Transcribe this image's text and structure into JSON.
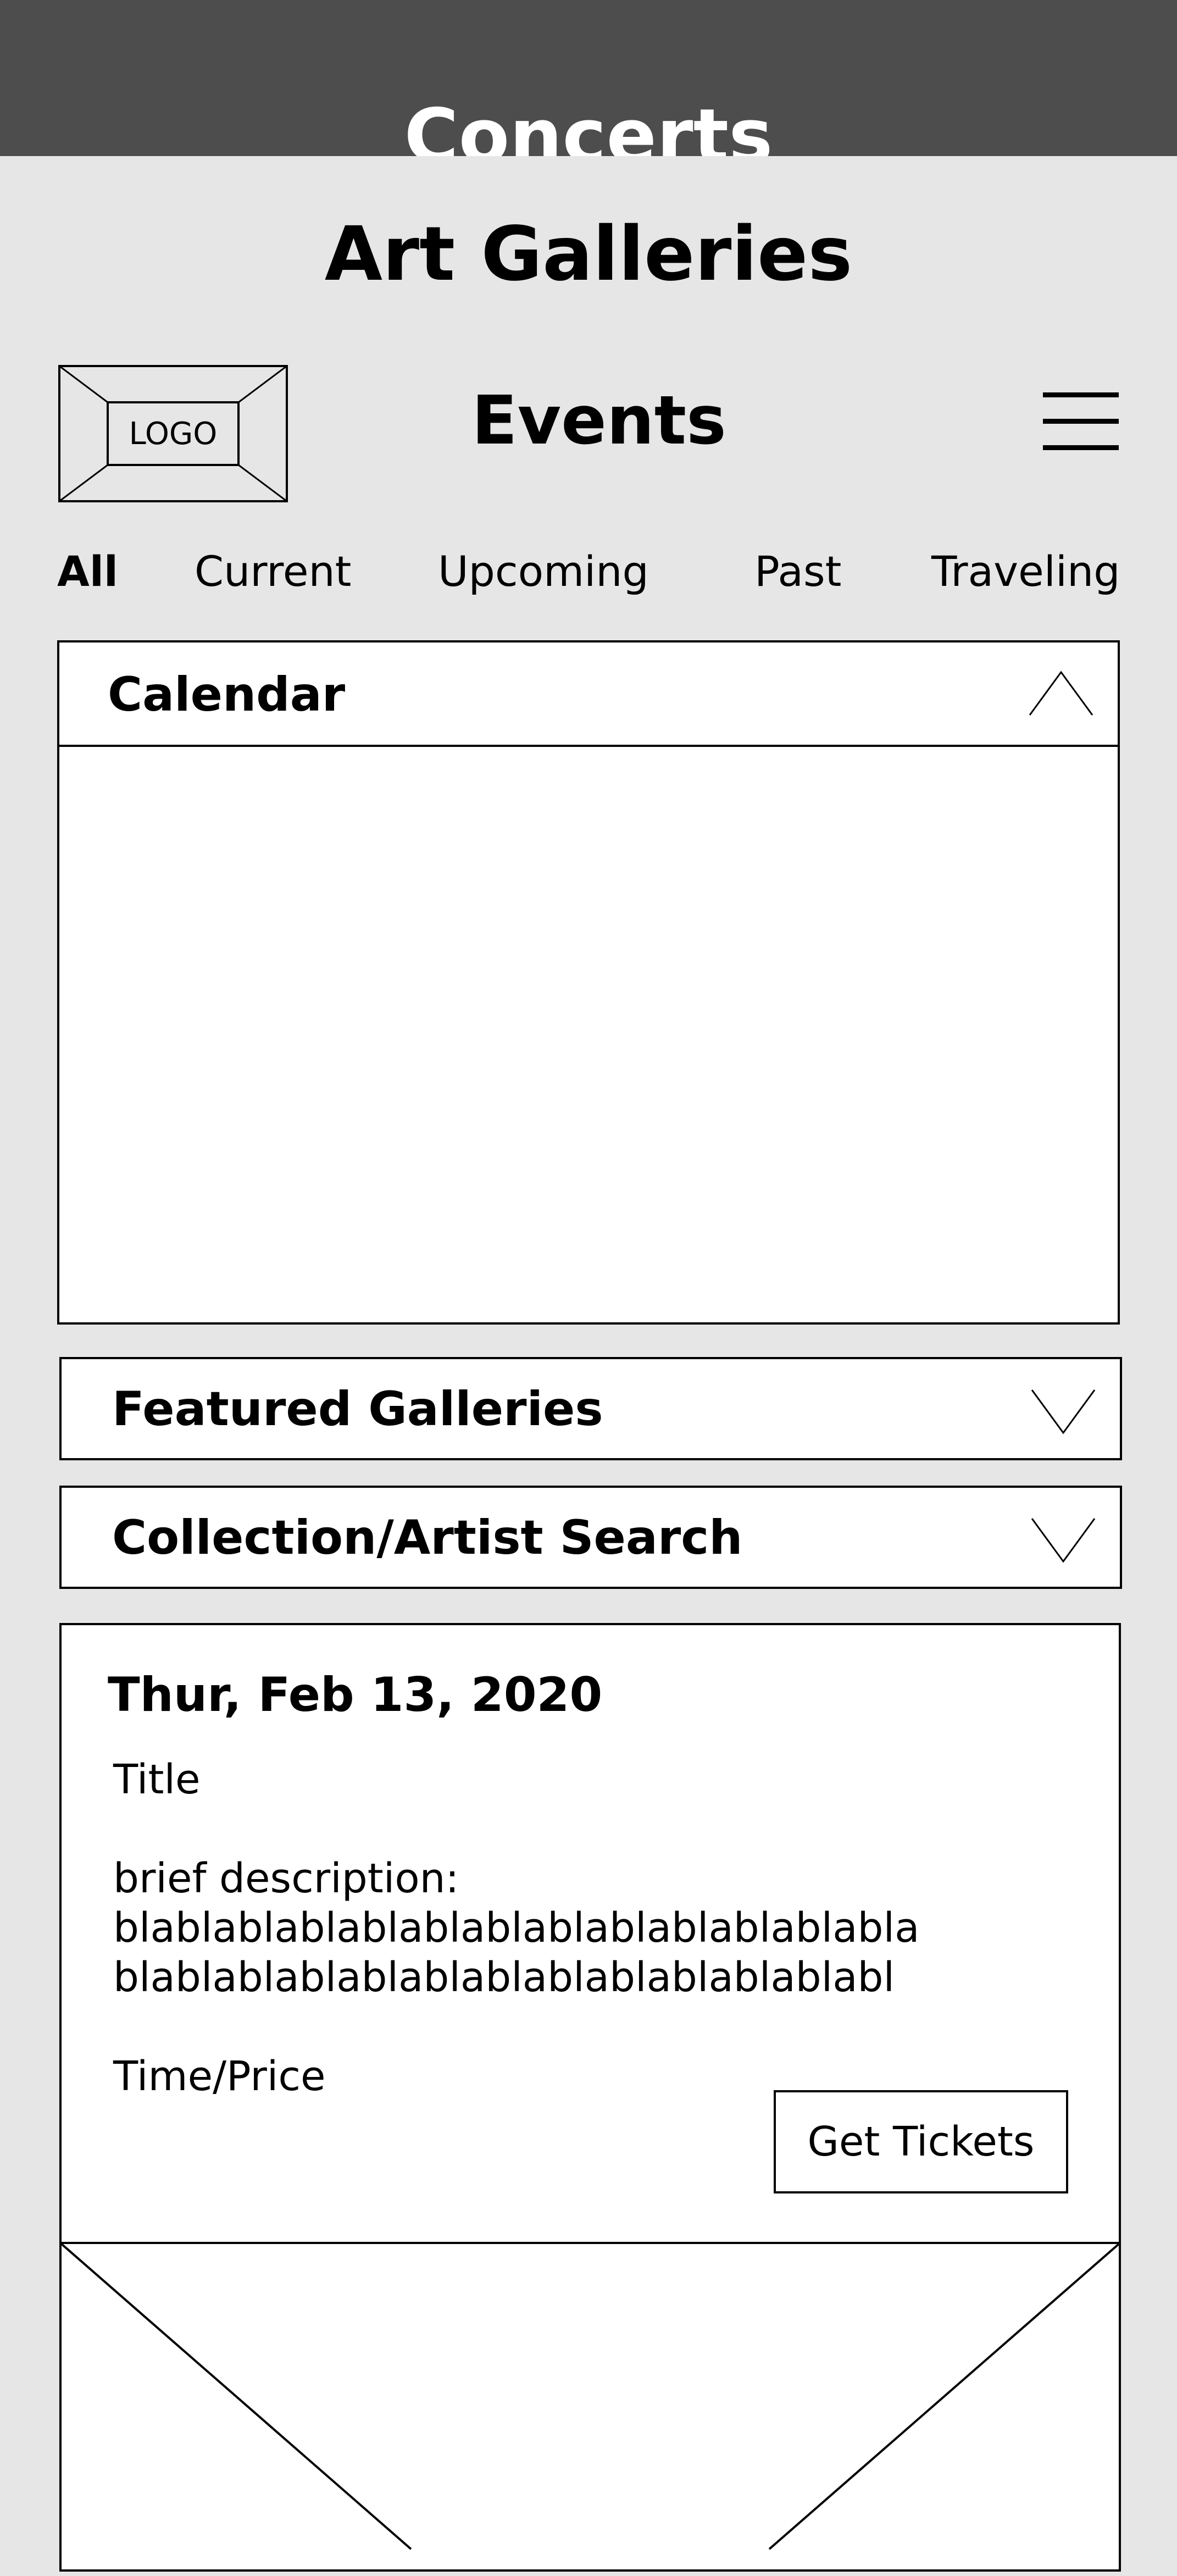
{
  "overlay": {
    "title": "Concerts"
  },
  "page": {
    "title": "Art Galleries"
  },
  "header": {
    "logo_label": "LOGO",
    "title": "Events",
    "menu_icon": "hamburger-menu-icon"
  },
  "tabs": [
    {
      "label": "All",
      "active": true
    },
    {
      "label": "Current",
      "active": false
    },
    {
      "label": "Upcoming",
      "active": false
    },
    {
      "label": "Past",
      "active": false
    },
    {
      "label": "Traveling",
      "active": false
    }
  ],
  "calendar": {
    "title": "Calendar",
    "icon": "chevron-up-icon"
  },
  "featured": {
    "title": "Featured Galleries",
    "icon": "chevron-down-icon"
  },
  "search": {
    "title": "Collection/Artist Search",
    "icon": "chevron-down-icon"
  },
  "event": {
    "date": "Thur, Feb 13, 2020",
    "title": "Title",
    "description_label": "brief description:",
    "description_line1": "blablablablablablablablablablablablabla",
    "description_line2": "blablablablablablablablablablablablabl",
    "time_price": "Time/Price",
    "button_label": "Get Tickets"
  },
  "colors": {
    "overlay": "#4d4d4d",
    "background": "#e6e6e6",
    "panel": "#ffffff",
    "stroke": "#000000"
  }
}
